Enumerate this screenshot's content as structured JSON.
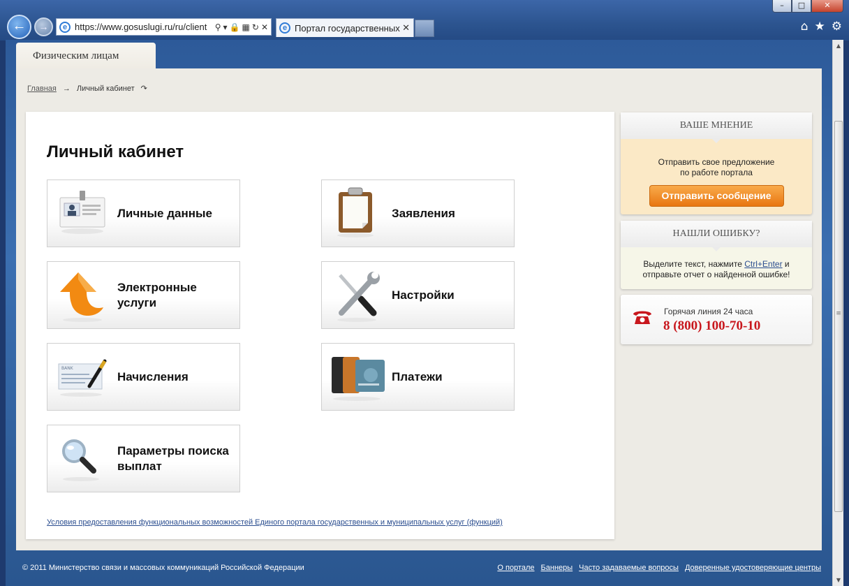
{
  "browser": {
    "address": "https://www.gosuslugi.ru/ru/client",
    "tab_title": "Портал государственных ...",
    "window_buttons": [
      "–",
      "□",
      "✕"
    ]
  },
  "page": {
    "section_tab": "Физическим лицам",
    "breadcrumb": {
      "home": "Главная",
      "current": "Личный кабинет"
    },
    "title": "Личный кабинет",
    "tiles": [
      {
        "label": "Личные данные",
        "icon": "id-card-icon"
      },
      {
        "label": "Заявления",
        "icon": "clipboard-icon"
      },
      {
        "label": "Электронные услуги",
        "icon": "orange-arrow-icon"
      },
      {
        "label": "Настройки",
        "icon": "tools-icon"
      },
      {
        "label": "Начисления",
        "icon": "bank-check-pen-icon"
      },
      {
        "label": "Платежи",
        "icon": "bank-cards-icon"
      },
      {
        "label": "Параметры поиска выплат",
        "icon": "magnifier-icon"
      }
    ],
    "terms_link": "Условия предоставления функциональных возможностей Единого портала государственных и муниципальных услуг (функций)"
  },
  "sidebar": {
    "opinion": {
      "header": "ВАШЕ МНЕНИЕ",
      "text1": "Отправить свое предложение",
      "text2": "по работе портала",
      "button": "Отправить сообщение"
    },
    "error": {
      "header": "НАШЛИ ОШИБКУ?",
      "text_before": "Выделите текст, нажмите ",
      "shortcut": "Ctrl+Enter",
      "text_after": " и",
      "text2": "отправьте отчет о найденной ошибке!"
    },
    "hotline": {
      "label": "Горячая линия 24 часа",
      "phone": "8 (800) 100-70-10"
    }
  },
  "footer": {
    "copyright": "© 2011 Министерство связи и массовых коммуникаций Российской Федерации",
    "links": [
      "О портале",
      "Баннеры",
      "Часто задаваемые вопросы",
      "Доверенные удостоверяющие центры"
    ]
  },
  "colors": {
    "accent_orange": "#e87611",
    "phone_red": "#c8171d",
    "link_blue": "#2a4d8f"
  }
}
